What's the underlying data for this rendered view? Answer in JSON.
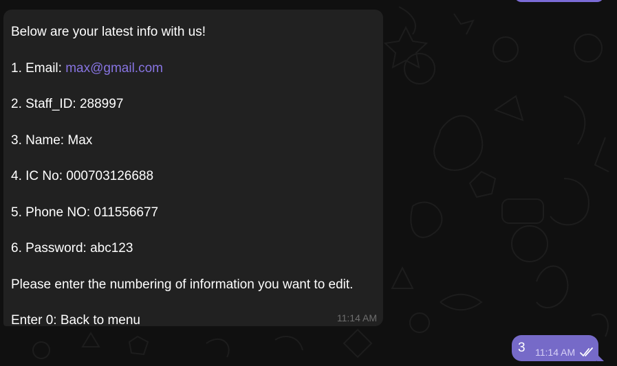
{
  "incoming_message": {
    "lines": [
      {
        "text": "Below are your latest info with us!"
      },
      {
        "label": "1. Email: ",
        "link": "max@gmail.com"
      },
      {
        "text": "2. Staff_ID: 288997"
      },
      {
        "text": "3. Name: Max"
      },
      {
        "text": "4. IC No: 000703126688"
      },
      {
        "text": "5. Phone NO: 011556677"
      },
      {
        "text": "6. Password: abc123"
      },
      {
        "text": "Please enter the numbering of information you want to edit."
      },
      {
        "text": "Enter 0: Back to menu"
      }
    ],
    "time": "11:14 AM"
  },
  "outgoing_message": {
    "text": "3",
    "time": "11:14 AM",
    "status_icon": "double-check-icon"
  },
  "colors": {
    "background": "#101010",
    "incoming_bubble": "#212121",
    "outgoing_bubble": "#766ac8",
    "link": "#8774e1",
    "timestamp": "#6f6f6f"
  }
}
